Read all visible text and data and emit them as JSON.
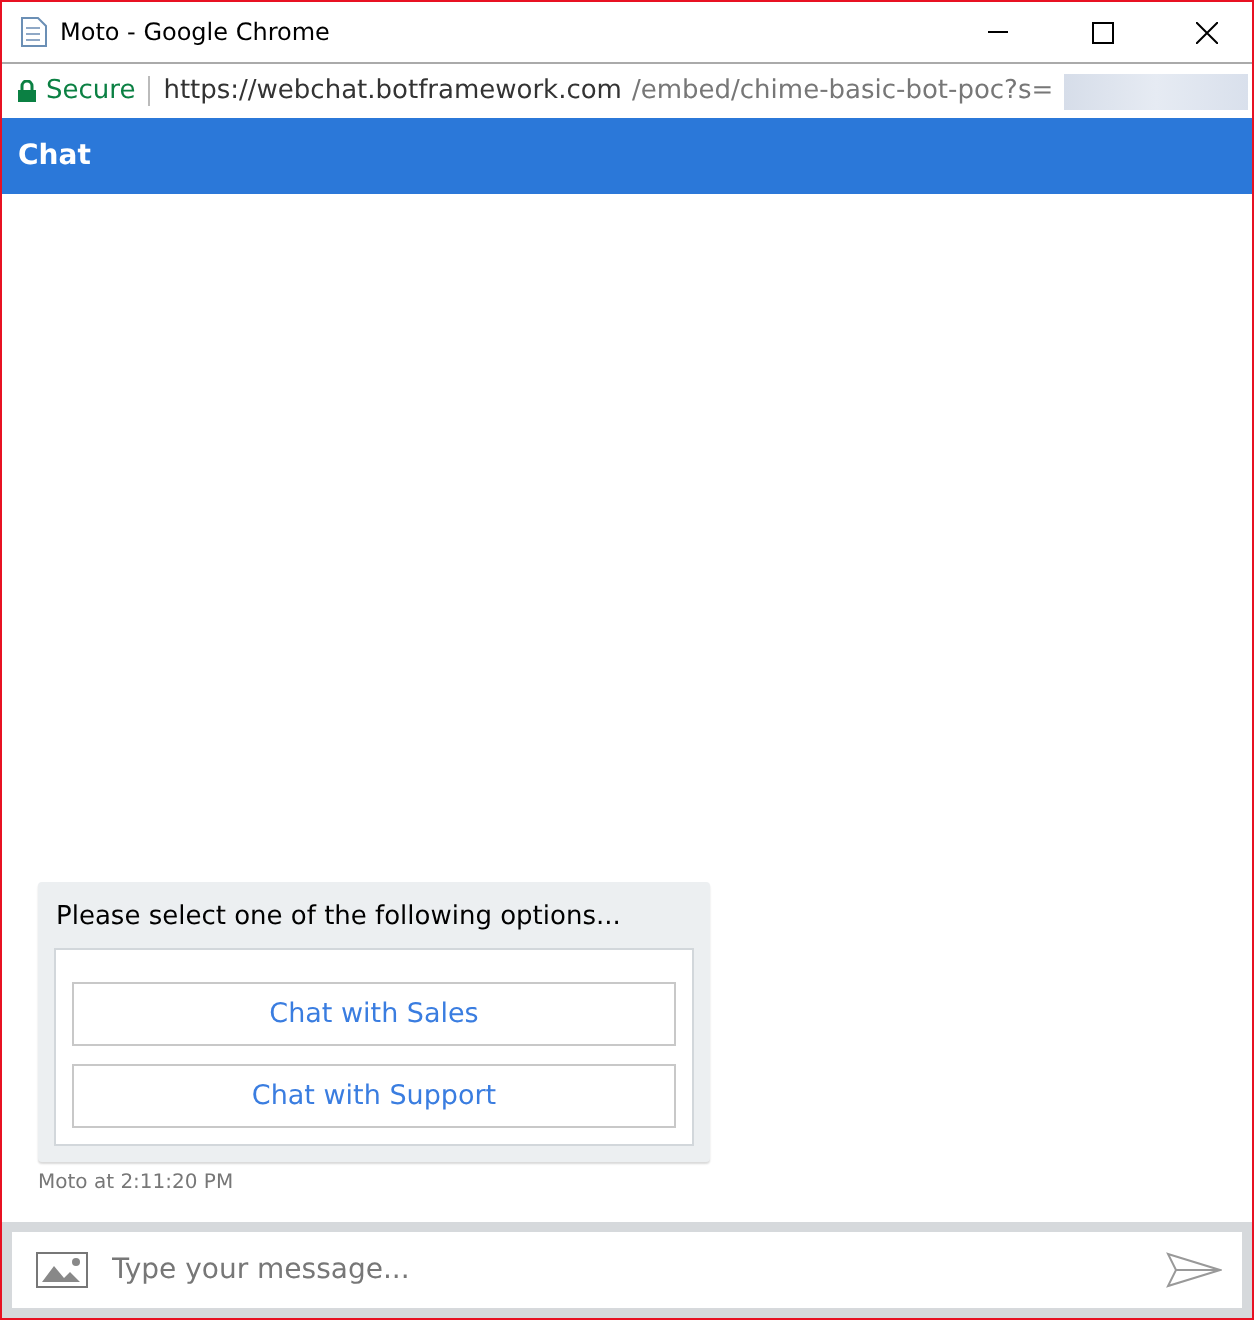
{
  "window": {
    "title": "Moto - Google Chrome"
  },
  "address_bar": {
    "security": "Secure",
    "url_host": "https://webchat.botframework.com",
    "url_path": "/embed/chime-basic-bot-poc?s="
  },
  "chat": {
    "header": "Chat",
    "messages": [
      {
        "text": "Please select one of the following options...",
        "buttons": [
          "Chat with Sales",
          "Chat with Support"
        ],
        "meta": "Moto at 2:11:20 PM"
      }
    ]
  },
  "composer": {
    "placeholder": "Type your message..."
  }
}
